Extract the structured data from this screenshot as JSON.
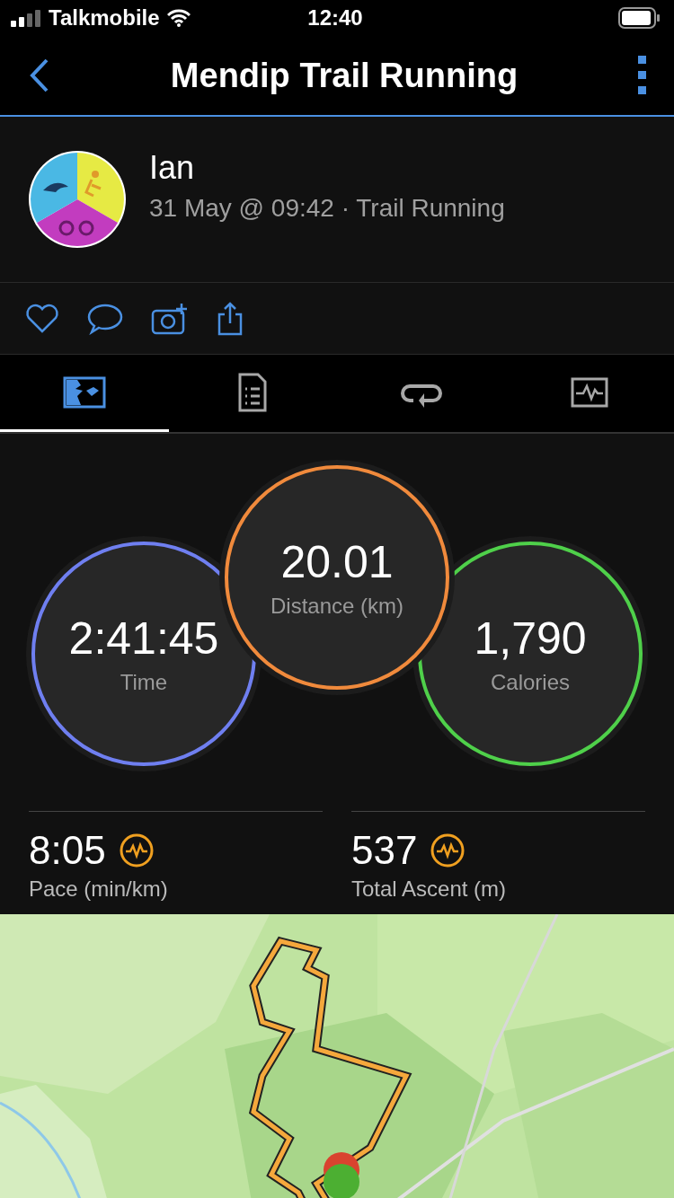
{
  "status_bar": {
    "carrier": "Talkmobile",
    "time": "12:40"
  },
  "header": {
    "title": "Mendip Trail Running"
  },
  "activity": {
    "name": "Ian",
    "subtitle": "31 May @ 09:42 · Trail Running"
  },
  "tabs": [
    {
      "kind": "map",
      "selected": true
    },
    {
      "kind": "details",
      "selected": false
    },
    {
      "kind": "laps",
      "selected": false
    },
    {
      "kind": "charts",
      "selected": false
    }
  ],
  "stats": [
    {
      "value": "2:41:45",
      "label": "Time",
      "color": "#6f7ff0"
    },
    {
      "value": "20.01",
      "label": "Distance (km)",
      "color": "#f08a3c"
    },
    {
      "value": "1,790",
      "label": "Calories",
      "color": "#4fd04a"
    }
  ],
  "metrics": [
    {
      "value": "8:05",
      "label": "Pace (min/km)"
    },
    {
      "value": "537",
      "label": "Total Ascent (m)"
    }
  ]
}
